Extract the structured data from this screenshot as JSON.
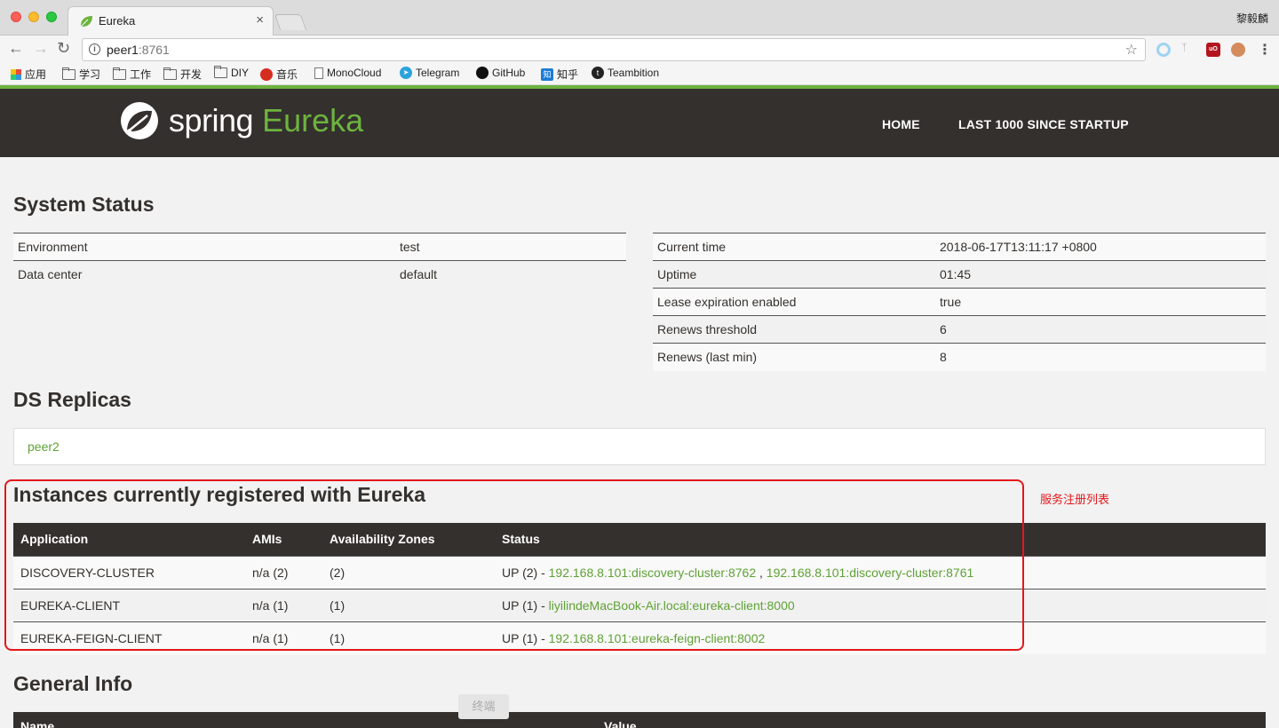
{
  "browser": {
    "tab_title": "Eureka",
    "tab_close": "×",
    "profile_name": "黎毅麟",
    "url_host": "peer1",
    "url_port": ":8761",
    "bookmarks": [
      "应用",
      "学习",
      "工作",
      "开发",
      "DIY",
      "音乐",
      "MonoCloud",
      "Telegram",
      "GitHub",
      "知乎",
      "Teambition"
    ]
  },
  "navbar": {
    "brand_spring": "spring",
    "brand_eureka": "Eureka",
    "links": [
      "HOME",
      "LAST 1000 SINCE STARTUP"
    ]
  },
  "system_status": {
    "title": "System Status",
    "left": [
      {
        "label": "Environment",
        "value": "test"
      },
      {
        "label": "Data center",
        "value": "default"
      }
    ],
    "right": [
      {
        "label": "Current time",
        "value": "2018-06-17T13:11:17 +0800"
      },
      {
        "label": "Uptime",
        "value": "01:45"
      },
      {
        "label": "Lease expiration enabled",
        "value": "true"
      },
      {
        "label": "Renews threshold",
        "value": "6"
      },
      {
        "label": "Renews (last min)",
        "value": "8"
      }
    ]
  },
  "ds_replicas": {
    "title": "DS Replicas",
    "items": [
      "peer2"
    ]
  },
  "instances": {
    "title": "Instances currently registered with Eureka",
    "annotation": "服务注册列表",
    "columns": [
      "Application",
      "AMIs",
      "Availability Zones",
      "Status"
    ],
    "rows": [
      {
        "application": "DISCOVERY-CLUSTER",
        "amis": "n/a (2)",
        "zones": "(2)",
        "status_prefix": "UP (2) - ",
        "links": [
          "192.168.8.101:discovery-cluster:8762",
          "192.168.8.101:discovery-cluster:8761"
        ],
        "separator": " , "
      },
      {
        "application": "EUREKA-CLIENT",
        "amis": "n/a (1)",
        "zones": "(1)",
        "status_prefix": "UP (1) - ",
        "links": [
          "liyilindeMacBook-Air.local:eureka-client:8000"
        ]
      },
      {
        "application": "EUREKA-FEIGN-CLIENT",
        "amis": "n/a (1)",
        "zones": "(1)",
        "status_prefix": "UP (1) - ",
        "links": [
          "192.168.8.101:eureka-feign-client:8002"
        ]
      }
    ]
  },
  "general_info": {
    "title": "General Info",
    "columns": [
      "Name",
      "Value"
    ]
  },
  "tooltip": "终端",
  "colors": {
    "accent": "#6db33f",
    "navbar_bg": "#34302d",
    "highlight": "#e4161b"
  }
}
